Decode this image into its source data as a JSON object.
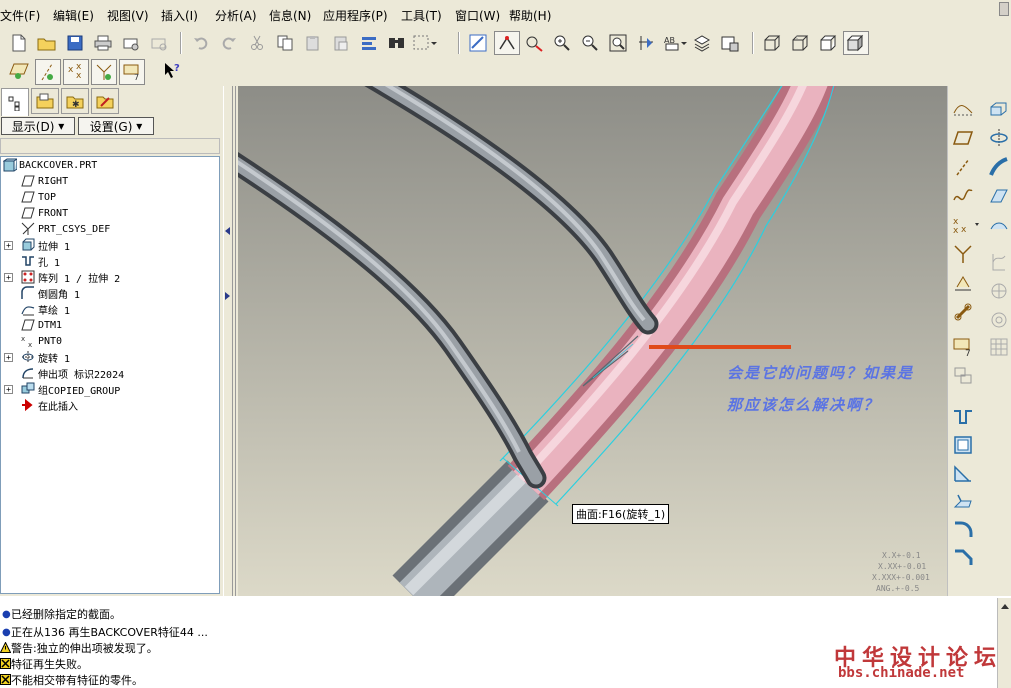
{
  "menu": [
    "文件(F)",
    "编辑(E)",
    "视图(V)",
    "插入(I)",
    "分析(A)",
    "信息(N)",
    "应用程序(P)",
    "工具(T)",
    "窗口(W)",
    "帮助(H)"
  ],
  "panel": {
    "show_label": "显示(D)",
    "settings_label": "设置(G)"
  },
  "tree": [
    {
      "label": "BACKCOVER.PRT",
      "icon": "part-icon"
    },
    {
      "label": "RIGHT",
      "icon": "datum-plane-icon"
    },
    {
      "label": "TOP",
      "icon": "datum-plane-icon"
    },
    {
      "label": "FRONT",
      "icon": "datum-plane-icon"
    },
    {
      "label": "PRT_CSYS_DEF",
      "icon": "csys-icon"
    },
    {
      "label": "拉伸 1",
      "icon": "extrude-icon"
    },
    {
      "label": "孔 1",
      "icon": "hole-icon"
    },
    {
      "label": "阵列 1 / 拉伸 2",
      "icon": "pattern-icon"
    },
    {
      "label": "倒圆角 1",
      "icon": "round-icon"
    },
    {
      "label": "草绘 1",
      "icon": "sketch-icon"
    },
    {
      "label": "DTM1",
      "icon": "datum-plane-icon"
    },
    {
      "label": "PNT0",
      "icon": "datum-point-icon"
    },
    {
      "label": "旋转 1",
      "icon": "revolve-icon"
    },
    {
      "label": "伸出项 标识22024",
      "icon": "protrusion-icon"
    },
    {
      "label": "组COPIED_GROUP",
      "icon": "group-icon"
    },
    {
      "label": "在此插入",
      "icon": "insert-here-icon"
    }
  ],
  "viewport": {
    "annotation_line1": "会是它的问题吗？如果是",
    "annotation_line2": "那应该怎么解决啊？",
    "tooltip": "曲面:F16(旋转_1)",
    "tolerances": [
      "X.X+-0.1",
      "X.XX+-0.01",
      "X.XXX+-0.001",
      "ANG.+-0.5"
    ]
  },
  "messages": [
    {
      "icon": "info-bullet-icon",
      "text": "已经删除指定的截面。"
    },
    {
      "icon": "info-bullet-icon",
      "text": "正在从136 再生BACKCOVER特征44 ..."
    },
    {
      "icon": "warning-icon",
      "text": "警告:独立的伸出项被发现了。"
    },
    {
      "icon": "error-icon",
      "text": "特征再生失败。"
    },
    {
      "icon": "error-icon",
      "text": "不能相交带有特征的零件。"
    }
  ],
  "watermark": {
    "title": "中华设计论坛",
    "url": "bbs.chinade.net"
  },
  "colors": {
    "viewport_top": "#8d8d87",
    "viewport_bottom": "#dcd9c8",
    "pink_surface": "#e6a4b4",
    "cyan_edge": "#2ad0e0",
    "annotation": "#5b74e3",
    "red_marker": "#e04a1a"
  }
}
